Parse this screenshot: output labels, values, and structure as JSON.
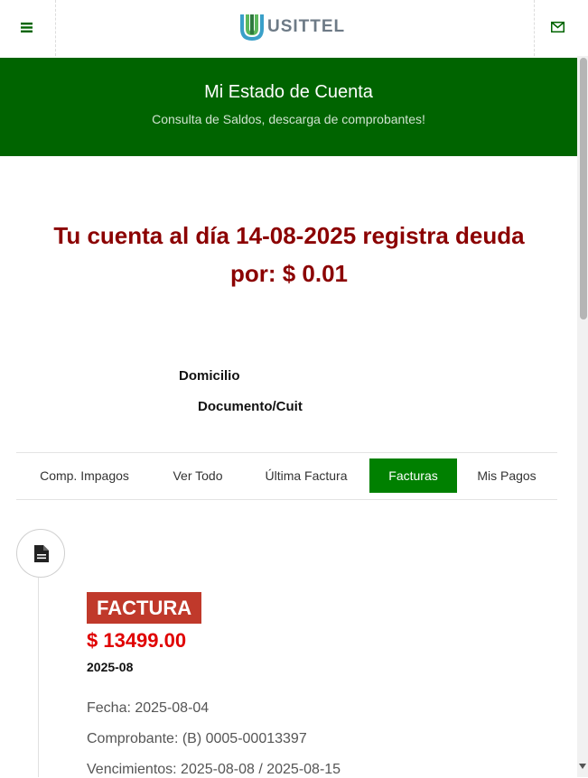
{
  "header": {
    "brand": "USITTEL",
    "menu_icon": "hamburger-menu-icon",
    "mail_icon": "envelope-icon",
    "accent_color": "#006400"
  },
  "hero": {
    "title": "Mi Estado de Cuenta",
    "subtitle": "Consulta de Saldos, descarga de comprobantes!"
  },
  "debt": {
    "line1": "Tu cuenta al día 14-08-2025 registra deuda",
    "line2": "por: $ 0.01"
  },
  "account": {
    "domicilio_label": "Domicilio",
    "documento_label": "Documento/Cuit"
  },
  "tabs": [
    {
      "label": "Comp. Impagos",
      "active": false
    },
    {
      "label": "Ver Todo",
      "active": false
    },
    {
      "label": "Última Factura",
      "active": false
    },
    {
      "label": "Facturas",
      "active": true
    },
    {
      "label": "Mis Pagos",
      "active": false
    }
  ],
  "invoice": {
    "icon": "document-icon",
    "type_badge": "FACTURA",
    "amount": "$ 13499.00",
    "period": "2025-08",
    "fecha": "Fecha: 2025-08-04",
    "comprobante": "Comprobante: (B) 0005-00013397",
    "vencimientos": "Vencimientos: 2025-08-08 / 2025-08-15"
  }
}
